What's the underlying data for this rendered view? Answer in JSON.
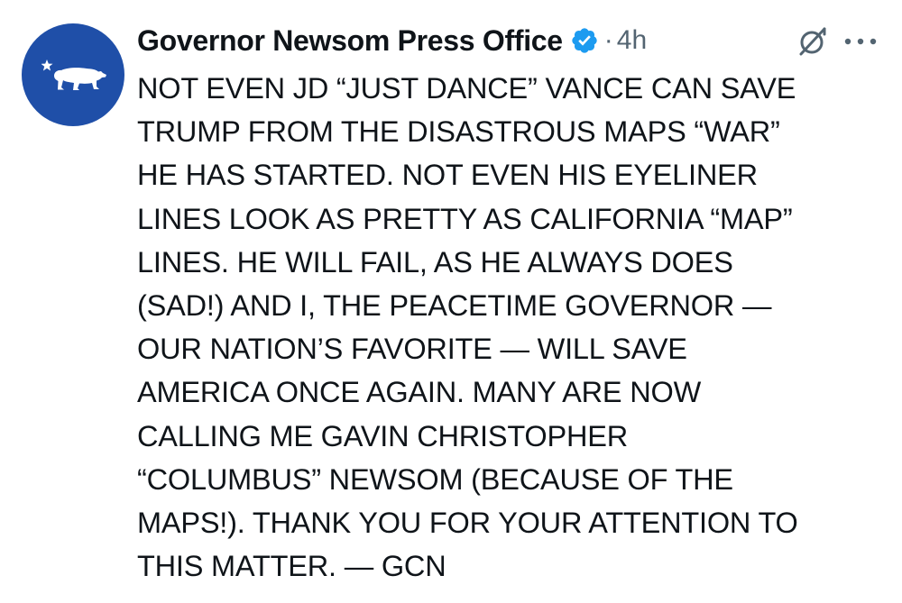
{
  "post": {
    "author_name": "Governor Newsom Press Office",
    "separator": "·",
    "time": "4h",
    "body_lines": [
      "NOT EVEN JD “JUST DANCE” VANCE CAN SAVE",
      "TRUMP FROM THE DISASTROUS MAPS “WAR”",
      "HE HAS STARTED. NOT EVEN HIS EYELINER",
      "LINES LOOK AS PRETTY AS CALIFORNIA “MAP”",
      "LINES. HE WILL FAIL, AS HE ALWAYS DOES",
      "(SAD!) AND I, THE PEACETIME GOVERNOR —",
      "OUR NATION’S FAVORITE — WILL SAVE",
      "AMERICA ONCE AGAIN. MANY ARE NOW",
      "CALLING ME GAVIN CHRISTOPHER",
      "“COLUMBUS” NEWSOM (BECAUSE OF THE",
      "MAPS!). THANK YOU FOR YOUR ATTENTION TO",
      "THIS MATTER. — GCN"
    ]
  },
  "icons": {
    "avatar": "california-bear-logo",
    "verified": "verified-badge-icon",
    "grok": "grok-icon",
    "more": "more-options-icon"
  },
  "colors": {
    "avatar_bg": "#1f4fa8",
    "verified_blue": "#1d9bf0",
    "text": "#0f1419",
    "secondary_text": "#536471"
  }
}
